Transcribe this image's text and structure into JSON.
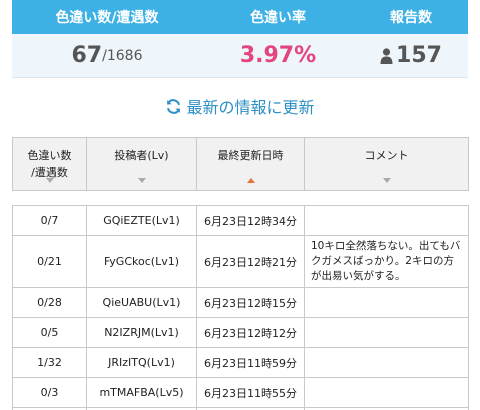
{
  "stats": {
    "headers": [
      "色違い数/遭遇数",
      "色違い率",
      "報告数"
    ],
    "shiny_count": "67",
    "encounter_count": "/1686",
    "rate": "3.97%",
    "reports": "157",
    "reports_icon": "person-icon",
    "header_color": "#3db1e5",
    "rate_color": "#e4457e"
  },
  "refresh": {
    "label": "最新の情報に更新",
    "icon": "refresh-icon",
    "color": "#2d8fc7"
  },
  "table": {
    "columns": [
      {
        "label_line1": "色違い数",
        "label_line2": "/遭遇数",
        "sort": "none"
      },
      {
        "label_line1": "投稿者(Lv)",
        "label_line2": "",
        "sort": "none"
      },
      {
        "label_line1": "最終更新日時",
        "label_line2": "",
        "sort": "desc-active"
      },
      {
        "label_line1": "コメント",
        "label_line2": "",
        "sort": "none"
      }
    ],
    "rows": [
      {
        "ratio": "0/7",
        "user": "GQiEZTE(Lv1)",
        "time": "6月23日12時34分",
        "comment": ""
      },
      {
        "ratio": "0/21",
        "user": "FyGCkoc(Lv1)",
        "time": "6月23日12時21分",
        "comment": "10キロ全然落ちない。出てもバクガメスばっかり。2キロの方が出易い気がする。"
      },
      {
        "ratio": "0/28",
        "user": "QieUABU(Lv1)",
        "time": "6月23日12時15分",
        "comment": ""
      },
      {
        "ratio": "0/5",
        "user": "N2IZRJM(Lv1)",
        "time": "6月23日12時12分",
        "comment": ""
      },
      {
        "ratio": "1/32",
        "user": "JRIzITQ(Lv1)",
        "time": "6月23日11時59分",
        "comment": ""
      },
      {
        "ratio": "0/3",
        "user": "mTMAFBA(Lv5)",
        "time": "6月23日11時55分",
        "comment": ""
      }
    ]
  }
}
